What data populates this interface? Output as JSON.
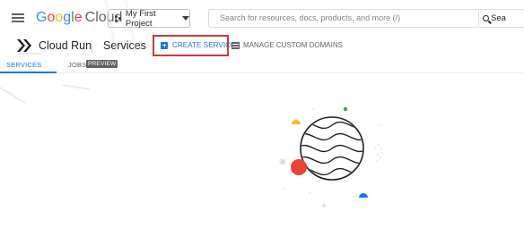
{
  "header": {
    "logo_letters": [
      "G",
      "o",
      "o",
      "g",
      "l",
      "e"
    ],
    "logo_suffix": "Cloud",
    "project_label": "My First Project",
    "search_placeholder": "Search for resources, docs, products, and more (/)",
    "search_button_label": "Sea"
  },
  "service_bar": {
    "product_name": "Cloud Run",
    "page_title": "Services",
    "create_label": "CREATE SERVICE",
    "domains_label": "MANAGE CUSTOM DOMAINS"
  },
  "tabs": {
    "services_label": "SERVICES",
    "jobs_label": "JOBS",
    "preview_badge": "PREVIEW"
  },
  "colors": {
    "accent": "#1a73e8",
    "highlight_box": "#cc3b3b",
    "dot_green": "#34a853",
    "dot_yellow": "#fbbc04",
    "dot_red": "#ea4335",
    "dot_blue": "#1a73e8"
  }
}
